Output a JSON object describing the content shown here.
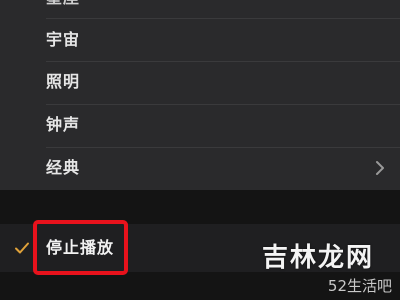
{
  "menu": {
    "items": [
      {
        "label": "星座",
        "partial": true
      },
      {
        "label": "宇宙"
      },
      {
        "label": "照明"
      },
      {
        "label": "钟声"
      },
      {
        "label": "经典",
        "has_submenu": true
      }
    ],
    "stop_item": {
      "label": "停止播放",
      "checked": true
    }
  },
  "colors": {
    "check": "#e0a23a",
    "highlight_box": "#e8121c"
  },
  "watermark": {
    "main": "吉林龙网",
    "sub": "52生活吧"
  }
}
